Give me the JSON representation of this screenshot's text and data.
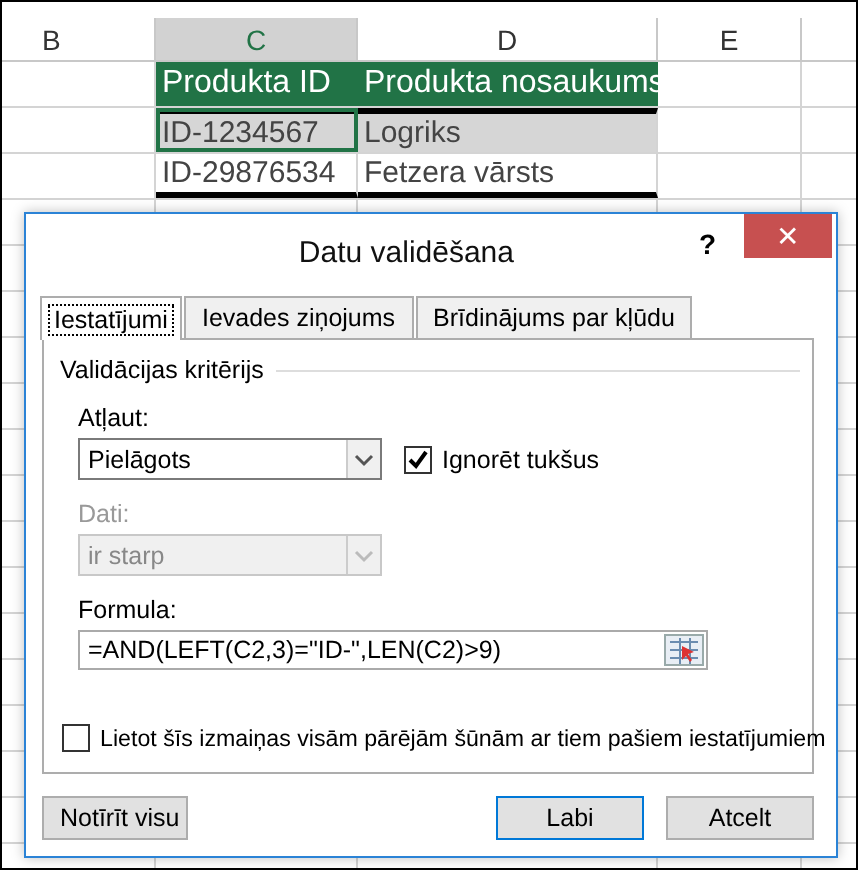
{
  "columns": [
    {
      "label": "B",
      "selected": false
    },
    {
      "label": "C",
      "selected": true
    },
    {
      "label": "D",
      "selected": false
    },
    {
      "label": "E",
      "selected": false
    }
  ],
  "table": {
    "header": [
      "Produkta ID",
      "Produkta nosaukums"
    ],
    "rows": [
      {
        "cells": [
          "ID-1234567",
          "Logriks"
        ],
        "selected": true
      },
      {
        "cells": [
          "ID-29876534",
          "Fetzera vārsts"
        ],
        "selected": false
      }
    ]
  },
  "dialog": {
    "title": "Datu validēšana",
    "help": "?",
    "close": "✕",
    "tabs": [
      {
        "label": "Iestatījumi",
        "selected": true
      },
      {
        "label": "Ievades ziņojums",
        "selected": false
      },
      {
        "label": "Brīdinājums par kļūdu",
        "selected": false
      }
    ],
    "group": "Validācijas kritērijs",
    "allow": {
      "label": "Atļaut:",
      "value": "Pielāgots",
      "disabled": false
    },
    "ignore_blank": {
      "label": "Ignorēt tukšus",
      "checked": true
    },
    "data": {
      "label": "Dati:",
      "value": "ir starp",
      "disabled": true
    },
    "formula": {
      "label": "Formula:",
      "value": "=AND(LEFT(C2,3)=\"ID-\",LEN(C2)>9)"
    },
    "apply_all": {
      "label": "Lietot šīs izmaiņas visām pārējām šūnām ar tiem pašiem iestatījumiem",
      "checked": false
    },
    "buttons": [
      {
        "label": "Notīrīt visu",
        "kind": "secondary"
      },
      {
        "label": "Labi",
        "kind": "default"
      },
      {
        "label": "Atcelt",
        "kind": "normal"
      }
    ]
  }
}
